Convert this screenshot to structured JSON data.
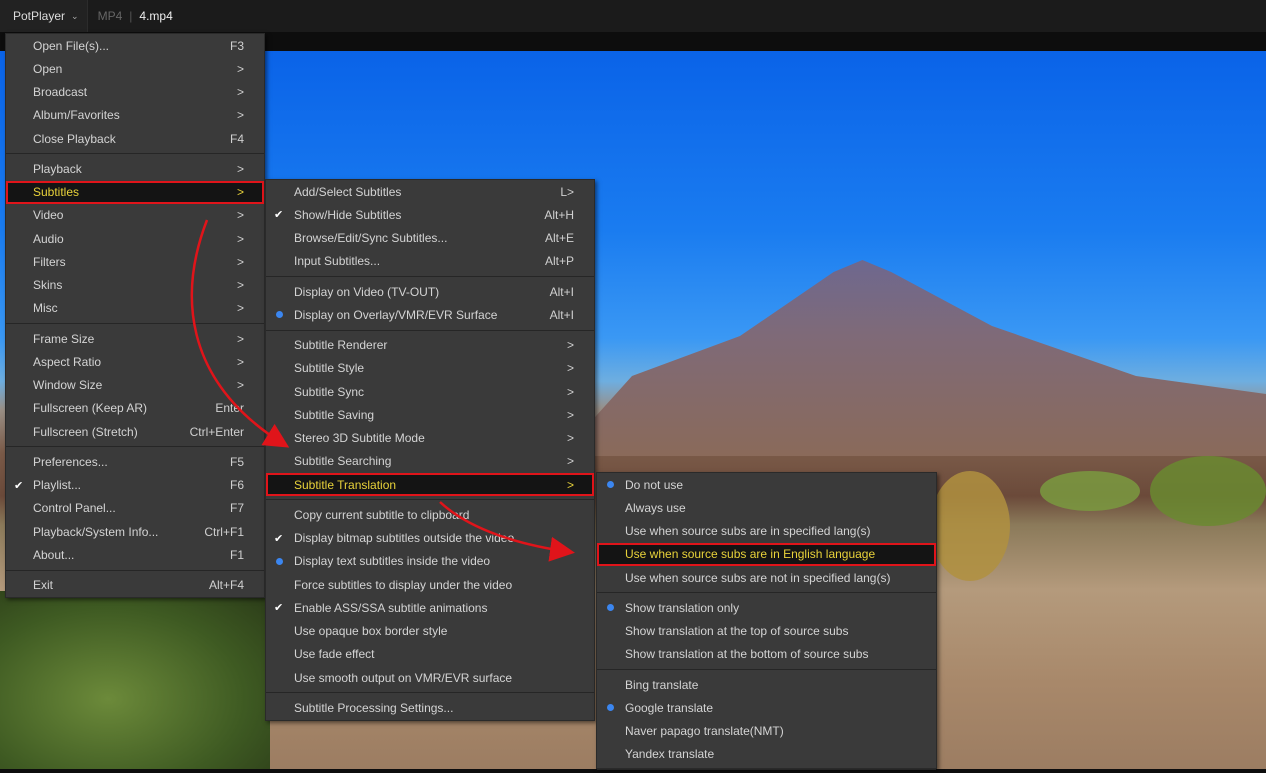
{
  "topbar": {
    "app_name": "PotPlayer",
    "format": "MP4",
    "separator": "|",
    "file_name": "4.mp4"
  },
  "colors": {
    "highlight_text": "#e8d23a",
    "annotation_red": "#e0141a",
    "radio_blue": "#3b86f0",
    "menu_bg": "#3a3a3a"
  },
  "menus": {
    "main": [
      {
        "label": "Open File(s)...",
        "shortcut": "F3"
      },
      {
        "label": "Open",
        "shortcut": ">"
      },
      {
        "label": "Broadcast",
        "shortcut": ">"
      },
      {
        "label": "Album/Favorites",
        "shortcut": ">"
      },
      {
        "label": "Close Playback",
        "shortcut": "F4"
      },
      {
        "sep": true
      },
      {
        "label": "Playback",
        "shortcut": ">"
      },
      {
        "label": "Subtitles",
        "shortcut": ">",
        "highlighted": true
      },
      {
        "label": "Video",
        "shortcut": ">"
      },
      {
        "label": "Audio",
        "shortcut": ">"
      },
      {
        "label": "Filters",
        "shortcut": ">"
      },
      {
        "label": "Skins",
        "shortcut": ">"
      },
      {
        "label": "Misc",
        "shortcut": ">"
      },
      {
        "sep": true
      },
      {
        "label": "Frame Size",
        "shortcut": ">"
      },
      {
        "label": "Aspect Ratio",
        "shortcut": ">"
      },
      {
        "label": "Window Size",
        "shortcut": ">"
      },
      {
        "label": "Fullscreen (Keep AR)",
        "shortcut": "Enter"
      },
      {
        "label": "Fullscreen (Stretch)",
        "shortcut": "Ctrl+Enter"
      },
      {
        "sep": true
      },
      {
        "label": "Preferences...",
        "shortcut": "F5"
      },
      {
        "label": "Playlist...",
        "shortcut": "F6",
        "mark": "check"
      },
      {
        "label": "Control Panel...",
        "shortcut": "F7"
      },
      {
        "label": "Playback/System Info...",
        "shortcut": "Ctrl+F1"
      },
      {
        "label": "About...",
        "shortcut": "F1"
      },
      {
        "sep": true
      },
      {
        "label": "Exit",
        "shortcut": "Alt+F4"
      }
    ],
    "subtitles": [
      {
        "label": "Add/Select Subtitles",
        "shortcut": "L>"
      },
      {
        "label": "Show/Hide Subtitles",
        "shortcut": "Alt+H",
        "mark": "check"
      },
      {
        "label": "Browse/Edit/Sync Subtitles...",
        "shortcut": "Alt+E"
      },
      {
        "label": "Input Subtitles...",
        "shortcut": "Alt+P"
      },
      {
        "sep": true
      },
      {
        "label": "Display on Video (TV-OUT)",
        "shortcut": "Alt+I"
      },
      {
        "label": "Display on Overlay/VMR/EVR Surface",
        "shortcut": "Alt+I",
        "mark": "radio"
      },
      {
        "sep": true
      },
      {
        "label": "Subtitle Renderer",
        "shortcut": ">"
      },
      {
        "label": "Subtitle Style",
        "shortcut": ">"
      },
      {
        "label": "Subtitle Sync",
        "shortcut": ">"
      },
      {
        "label": "Subtitle Saving",
        "shortcut": ">"
      },
      {
        "label": "Stereo 3D Subtitle Mode",
        "shortcut": ">"
      },
      {
        "label": "Subtitle Searching",
        "shortcut": ">"
      },
      {
        "label": "Subtitle Translation",
        "shortcut": ">",
        "highlighted": true
      },
      {
        "sep": true
      },
      {
        "label": "Copy current subtitle to clipboard"
      },
      {
        "label": "Display bitmap subtitles outside the video",
        "mark": "check"
      },
      {
        "label": "Display text subtitles inside the video",
        "mark": "radio"
      },
      {
        "label": "Force subtitles to display under the video"
      },
      {
        "label": "Enable ASS/SSA subtitle animations",
        "mark": "check"
      },
      {
        "label": "Use opaque box border style"
      },
      {
        "label": "Use fade effect"
      },
      {
        "label": "Use smooth output on VMR/EVR surface"
      },
      {
        "sep": true
      },
      {
        "label": "Subtitle Processing Settings..."
      }
    ],
    "translation": [
      {
        "label": "Do not use",
        "mark": "radio"
      },
      {
        "label": "Always use"
      },
      {
        "label": "Use when source subs are in specified lang(s)"
      },
      {
        "label": "Use when source subs are in English language",
        "highlighted": true
      },
      {
        "label": "Use when source subs are not in specified lang(s)"
      },
      {
        "sep": true
      },
      {
        "label": "Show translation only",
        "mark": "radio"
      },
      {
        "label": "Show translation at the top of source subs"
      },
      {
        "label": "Show translation at the bottom of source subs"
      },
      {
        "sep": true
      },
      {
        "label": "Bing translate"
      },
      {
        "label": "Google translate",
        "mark": "radio"
      },
      {
        "label": "Naver papago translate(NMT)"
      },
      {
        "label": "Yandex translate"
      },
      {
        "sep": true
      }
    ]
  }
}
